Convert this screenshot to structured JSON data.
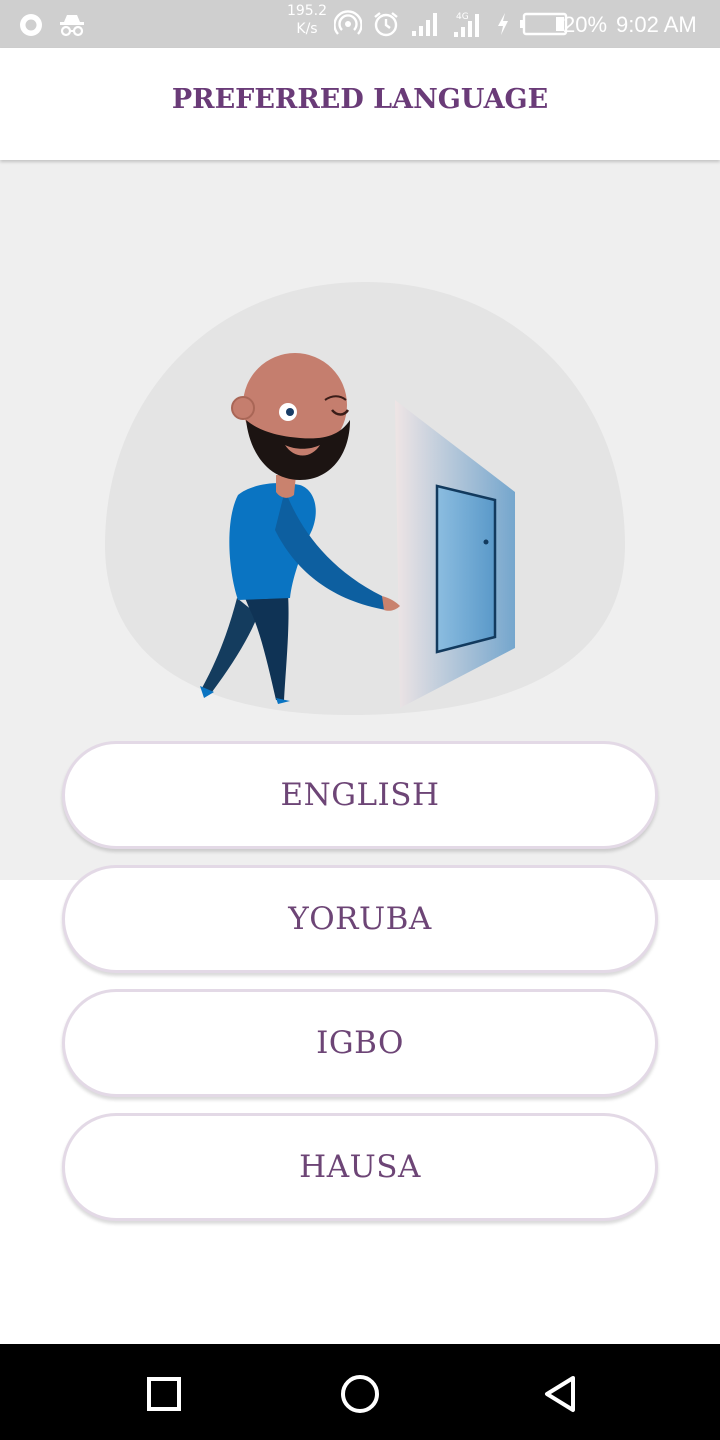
{
  "status_bar": {
    "network_speed_value": "195.2",
    "network_speed_unit": "K/s",
    "battery_percent": "20%",
    "time": "9:02 AM",
    "icons": [
      "record-icon",
      "incognito-icon",
      "hotspot-icon",
      "alarm-icon",
      "signal-icon",
      "signal-4g-icon",
      "charging-icon",
      "battery-icon"
    ]
  },
  "header": {
    "title": "PREFERRED LANGUAGE"
  },
  "languages": [
    {
      "label": "ENGLISH"
    },
    {
      "label": "YORUBA"
    },
    {
      "label": "IGBO"
    },
    {
      "label": "HAUSA"
    }
  ],
  "nav_bar": {
    "icons": [
      "recents-icon",
      "home-icon",
      "back-icon"
    ]
  },
  "colors": {
    "accent": "#6a3b78",
    "hero_background": "#efefef",
    "button_border": "#e3d9e6",
    "status_bar": "#cfcfcf"
  }
}
